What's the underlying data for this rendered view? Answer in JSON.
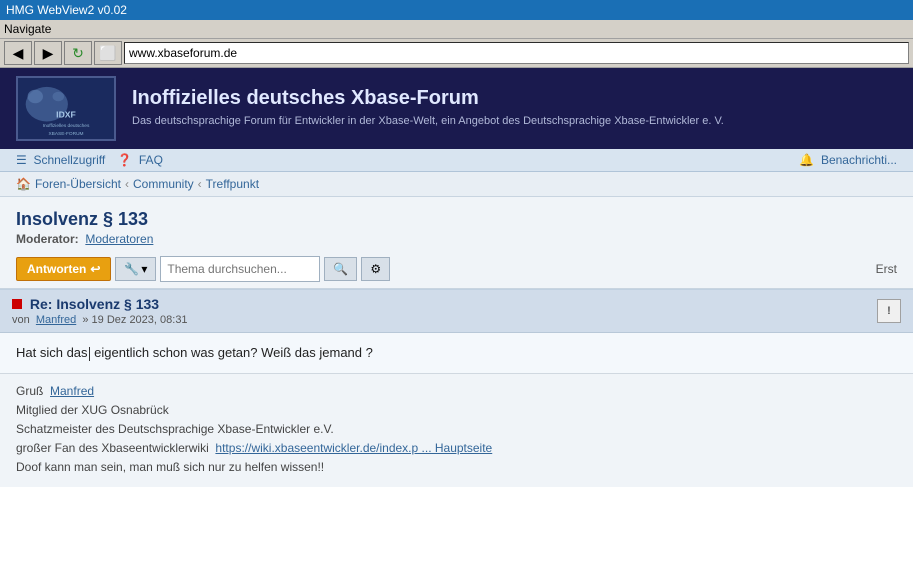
{
  "titlebar": {
    "title": "HMG WebView2 v0.02"
  },
  "menubar": {
    "label": "Navigate"
  },
  "toolbar": {
    "address": "www.xbaseforum.de"
  },
  "banner": {
    "title": "Inoffizielles deutsches Xbase-Forum",
    "subtitle": "Das deutschsprachige Forum für Entwickler in der Xbase-Welt, ein Angebot des Deutschsprachige Xbase-Entwickler e. V.",
    "logo_line1": "IDXF",
    "logo_line2": "Inoffizielles deutsches",
    "logo_line3": "XBASE-FORUM"
  },
  "navbar": {
    "schnellzugriff": "Schnellzugriff",
    "faq": "FAQ",
    "benachrichtigungen": "Benachrichti..."
  },
  "breadcrumb": {
    "home_icon": "🏠",
    "items": [
      {
        "label": "Foren-Übersicht",
        "sep": "‹"
      },
      {
        "label": "Community",
        "sep": "‹"
      },
      {
        "label": "Treffpunkt",
        "sep": ""
      }
    ]
  },
  "page": {
    "title": "Insolvenz § 133",
    "moderator_label": "Moderator:",
    "moderator_name": "Moderatoren"
  },
  "post_toolbar": {
    "reply_label": "Antworten",
    "tools_label": "⚙",
    "tools_dropdown": "▾",
    "search_placeholder": "Thema durchsuchen...",
    "search_icon": "🔍",
    "advanced_icon": "⚙",
    "right_label": "Erst"
  },
  "post": {
    "title": "Re: Insolvenz § 133",
    "flag_color": "#cc0000",
    "author_prefix": "von",
    "author": "Manfred",
    "date": "» 19 Dez 2023, 08:31",
    "body": "Hat sich das eigentlich schon was getan? Weiß das jemand ?",
    "report_label": "!",
    "signature": {
      "greeting": "Gruß",
      "author_link": "Manfred",
      "lines": [
        "Mitglied der XUG Osnabrück",
        "Schatzmeister des Deutschsprachige Xbase-Entwickler e.V.",
        "großer Fan des Xbaseentwicklerwiki",
        "Doof kann man sein, man muß sich nur zu helfen wissen!!"
      ],
      "wiki_url_text": "https://wiki.xbaseentwickler.de/index.p ... Hauptseite"
    }
  }
}
